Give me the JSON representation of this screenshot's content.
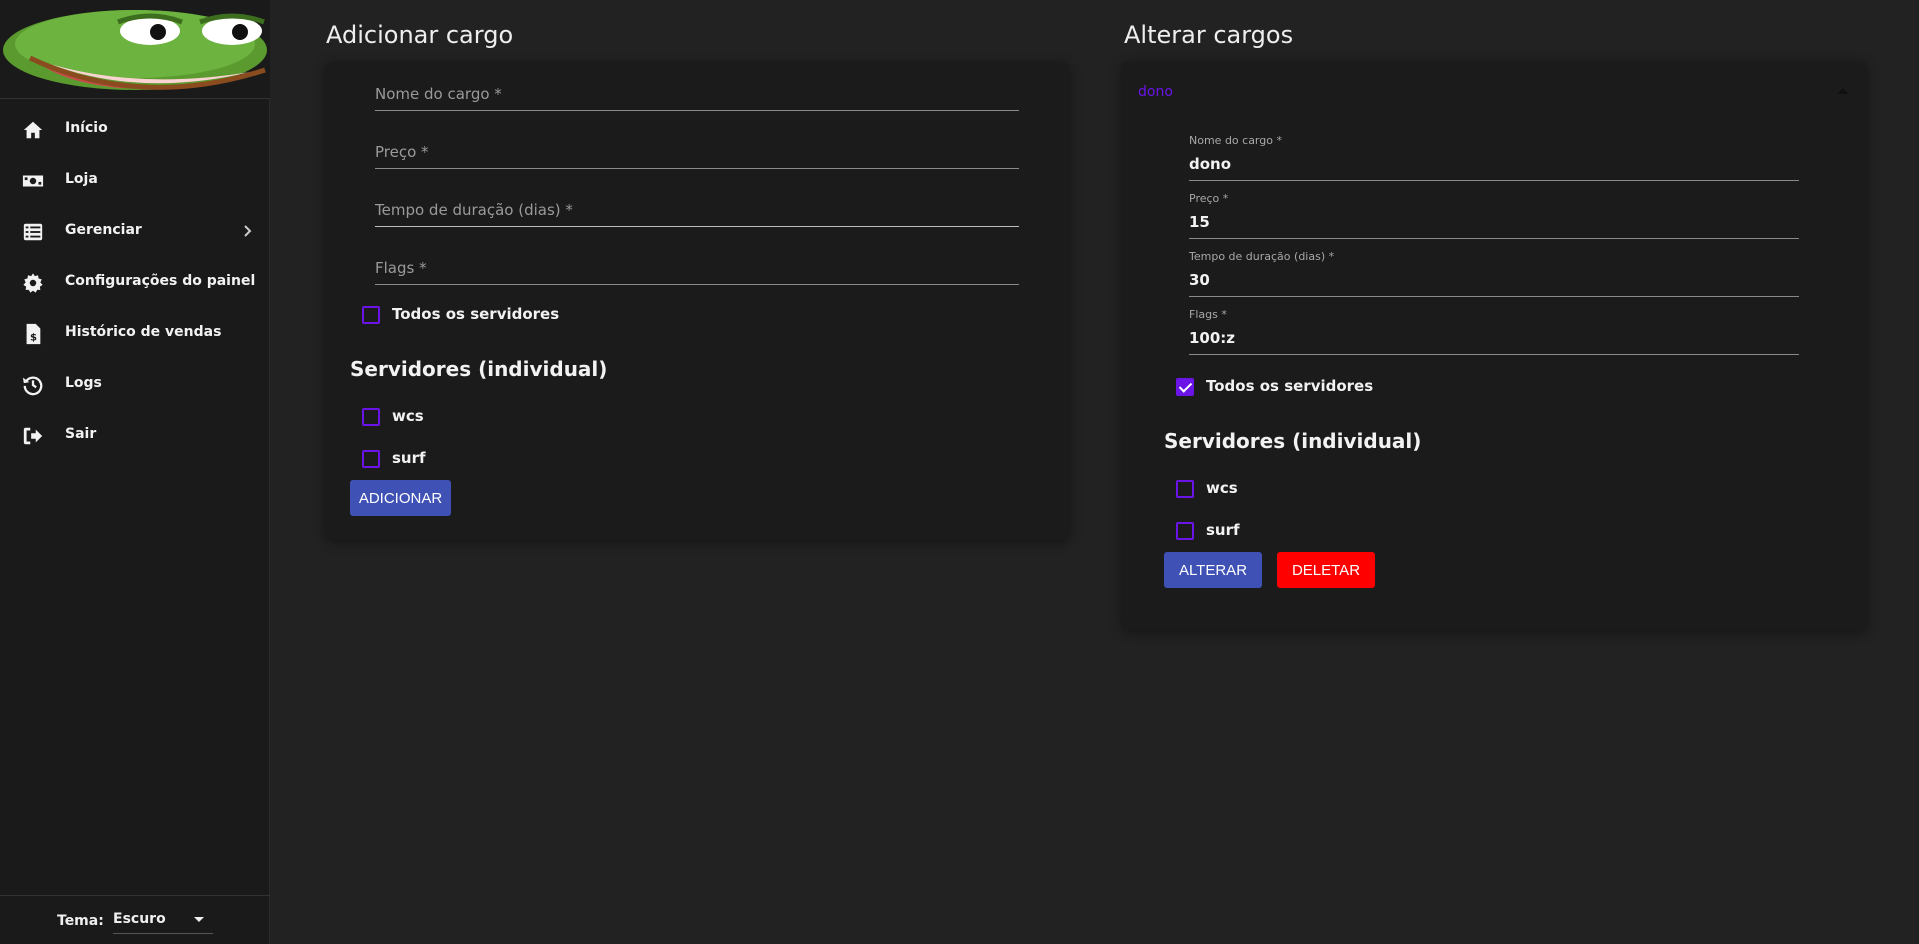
{
  "sidebar": {
    "items": [
      {
        "label": "Início",
        "icon": "home-icon"
      },
      {
        "label": "Loja",
        "icon": "money-icon"
      },
      {
        "label": "Gerenciar",
        "icon": "list-icon"
      },
      {
        "label": "Configurações do painel",
        "icon": "gear-icon"
      },
      {
        "label": "Histórico de vendas",
        "icon": "dollar-file-icon"
      },
      {
        "label": "Logs",
        "icon": "history-icon"
      },
      {
        "label": "Sair",
        "icon": "sign-out-icon"
      }
    ],
    "theme": {
      "label": "Tema:",
      "value": "Escuro"
    }
  },
  "add_role": {
    "title": "Adicionar cargo",
    "fields": {
      "name_placeholder": "Nome do cargo *",
      "price_placeholder": "Preço *",
      "duration_placeholder": "Tempo de duração (dias) *",
      "flags_placeholder": "Flags *"
    },
    "all_servers_label": "Todos os servidores",
    "servers_title": "Servidores (individual)",
    "servers": [
      "wcs",
      "surf"
    ],
    "submit_label": "ADICIONAR"
  },
  "edit_roles": {
    "title": "Alterar cargos",
    "panel_title": "dono",
    "fields": {
      "name_label": "Nome do cargo *",
      "name_value": "dono",
      "price_label": "Preço *",
      "price_value": "15",
      "duration_label": "Tempo de duração (dias) *",
      "duration_value": "30",
      "flags_label": "Flags *",
      "flags_value": "100:z"
    },
    "all_servers_label": "Todos os servidores",
    "all_servers_checked": true,
    "servers_title": "Servidores (individual)",
    "servers": [
      "wcs",
      "surf"
    ],
    "update_label": "ALTERAR",
    "delete_label": "DELETAR"
  },
  "colors": {
    "accent_purple": "#6a14e8",
    "primary_button": "#3f51b5",
    "danger_button": "#ff0000",
    "background": "#222222",
    "card": "#1b1b1b"
  }
}
